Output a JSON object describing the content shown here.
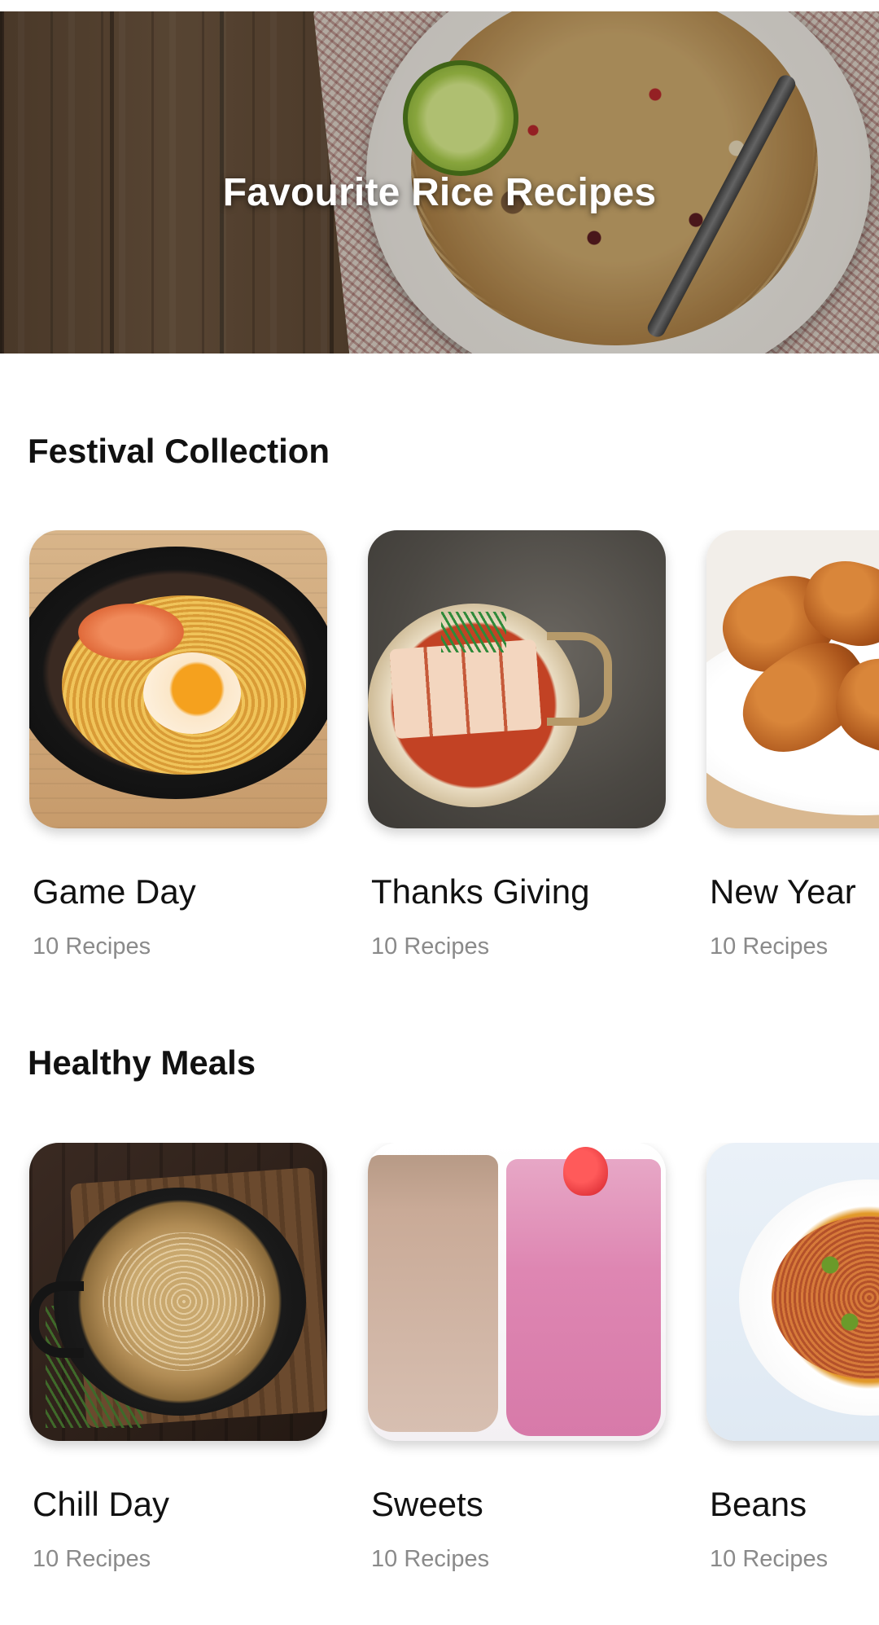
{
  "hero": {
    "title": "Favourite Rice Recipes"
  },
  "sections": [
    {
      "title": "Festival Collection",
      "cards": [
        {
          "title": "Game Day",
          "count": "10 Recipes",
          "image": "noodle-soup-image"
        },
        {
          "title": "Thanks Giving",
          "count": "10 Recipes",
          "image": "tofu-stew-image"
        },
        {
          "title": "New Year",
          "count": "10 Recipes",
          "image": "chicken-wings-image"
        }
      ]
    },
    {
      "title": "Healthy Meals",
      "cards": [
        {
          "title": "Chill Day",
          "count": "10 Recipes",
          "image": "glass-noodles-image"
        },
        {
          "title": "Sweets",
          "count": "10 Recipes",
          "image": "smoothies-image"
        },
        {
          "title": "Beans",
          "count": "10 Recipes",
          "image": "beans-plate-image"
        }
      ]
    }
  ],
  "colors": {
    "title_text": "#111111",
    "subtitle_text": "#8a8a8a",
    "background": "#ffffff",
    "hero_text": "#ffffff"
  }
}
